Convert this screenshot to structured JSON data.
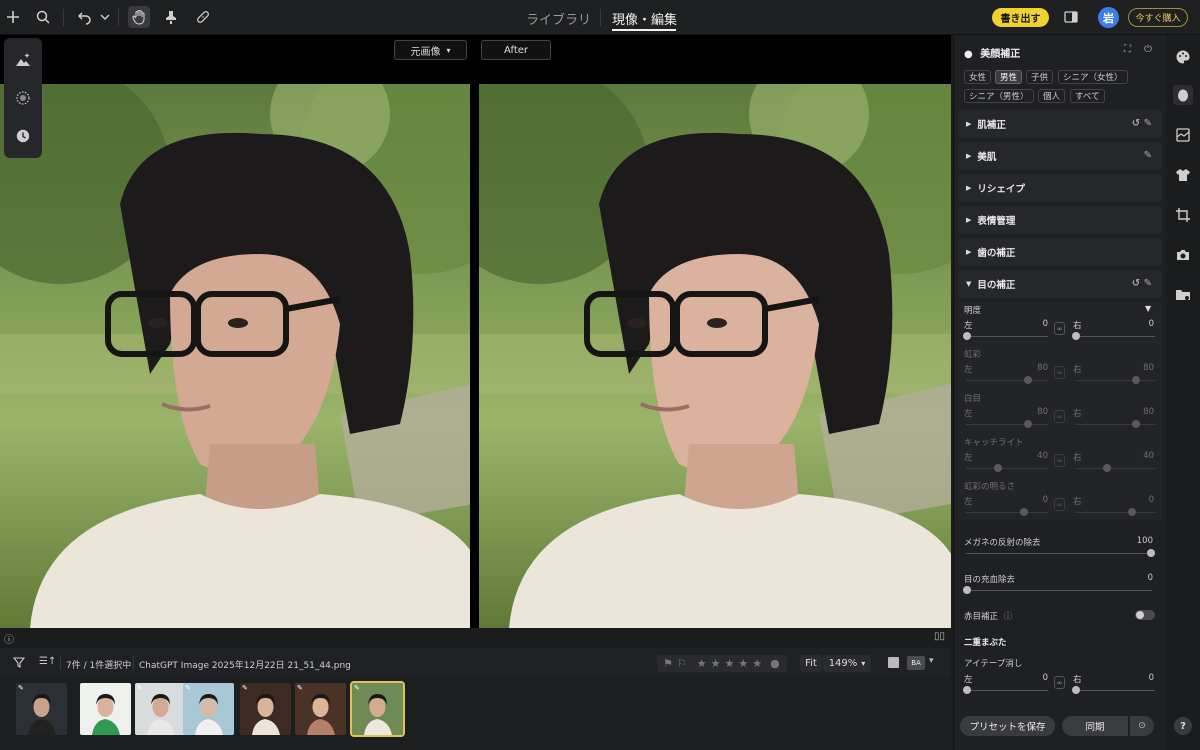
{
  "topbar": {
    "tabs": [
      "ライブラリ",
      "現像・編集"
    ],
    "export_label": "書き出す",
    "avatar_initial": "岩",
    "buy_label": "今すぐ購入"
  },
  "viewer": {
    "before_label": "元画像",
    "after_label": "After"
  },
  "filmstrip": {
    "count_text": "7件 / 1件選択中",
    "filename": "ChatGPT Image 2025年12月22日 21_51_44.png",
    "fit_label": "Fit",
    "zoom_value": "149%",
    "thumbs": [
      {
        "bg": "#2b3037",
        "skin": "#c9a28c",
        "shirt": "#222222"
      },
      {
        "bg": "#eef0ee",
        "skin": "#d8b29a",
        "shirt": "#2f9a52"
      },
      {
        "bg": "#d9dcdc",
        "skin": "#d2ab92",
        "shirt": "#e8e8e6"
      },
      {
        "bg": "#a8c8d6",
        "skin": "#d6b9a6",
        "shirt": "#f0f0f0"
      },
      {
        "bg": "#3d2a22",
        "skin": "#d9b39a",
        "shirt": "#e9e4dc"
      },
      {
        "bg": "#4a3226",
        "skin": "#dcb49a",
        "shirt": "#b4806a"
      },
      {
        "bg": "#6e8a55",
        "skin": "#d3ab92",
        "shirt": "#ece8de"
      }
    ]
  },
  "panel": {
    "title": "美顔補正",
    "chips": [
      "女性",
      "男性",
      "子供",
      "シニア（女性）",
      "シニア（男性）",
      "個人",
      "すべて"
    ],
    "sections": [
      "肌補正",
      "美肌",
      "リシェイプ",
      "表情管理",
      "歯の補正",
      "目の補正"
    ],
    "eye": {
      "brightness": {
        "label": "明度",
        "left_label": "左",
        "right_label": "右",
        "left_value": "0",
        "right_value": "0"
      },
      "iris": {
        "label": "虹彩",
        "left_label": "左",
        "right_label": "右",
        "left_value": "80",
        "right_value": "80"
      },
      "white": {
        "label": "白目",
        "left_label": "左",
        "right_label": "右",
        "left_value": "80",
        "right_value": "80"
      },
      "catchlight": {
        "label": "キャッチライト",
        "left_label": "左",
        "right_label": "右",
        "left_value": "40",
        "right_value": "40"
      },
      "iris_brightness": {
        "label": "虹彩の明るさ",
        "left_label": "左",
        "right_label": "右",
        "left_value": "0",
        "right_value": "0"
      }
    },
    "glasses_label": "メガネの反射の除去",
    "glasses_value": "100",
    "redness_label": "目の充血除去",
    "redness_value": "0",
    "redeye_label": "赤目補正",
    "double_eyelid_label": "二重まぶた",
    "eyetape_label": "アイテープ消し",
    "eyetape_left_label": "左",
    "eyetape_right_label": "右",
    "eyetape_left_value": "0",
    "eyetape_right_value": "0",
    "preset_label": "プリセットを保存",
    "sync_label": "同期"
  },
  "colors": {
    "accent_yellow": "#f2d230",
    "avatar_blue": "#3d7ee8"
  }
}
